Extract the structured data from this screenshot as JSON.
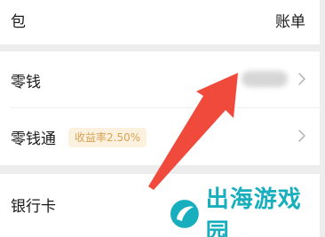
{
  "header": {
    "title": "包",
    "bill_label": "账单"
  },
  "wallet_items": [
    {
      "label": "零钱",
      "balance": "hidden (blurred)",
      "icon": "chevron-right-icon"
    },
    {
      "label": "零钱通",
      "badge": "收益率2.50%",
      "icon": "chevron-right-icon"
    }
  ],
  "bank_section": {
    "label": "银行卡"
  },
  "annotation": {
    "arrow_color": "#f04a3c",
    "description": "arrow pointing to the blurred balance"
  },
  "watermark": {
    "text": "出海游戏园",
    "color": "#17aebd"
  },
  "colors": {
    "background": "#ededed",
    "card": "#ffffff",
    "badge_text": "#d7a354",
    "badge_bg": "#fcf1df"
  }
}
